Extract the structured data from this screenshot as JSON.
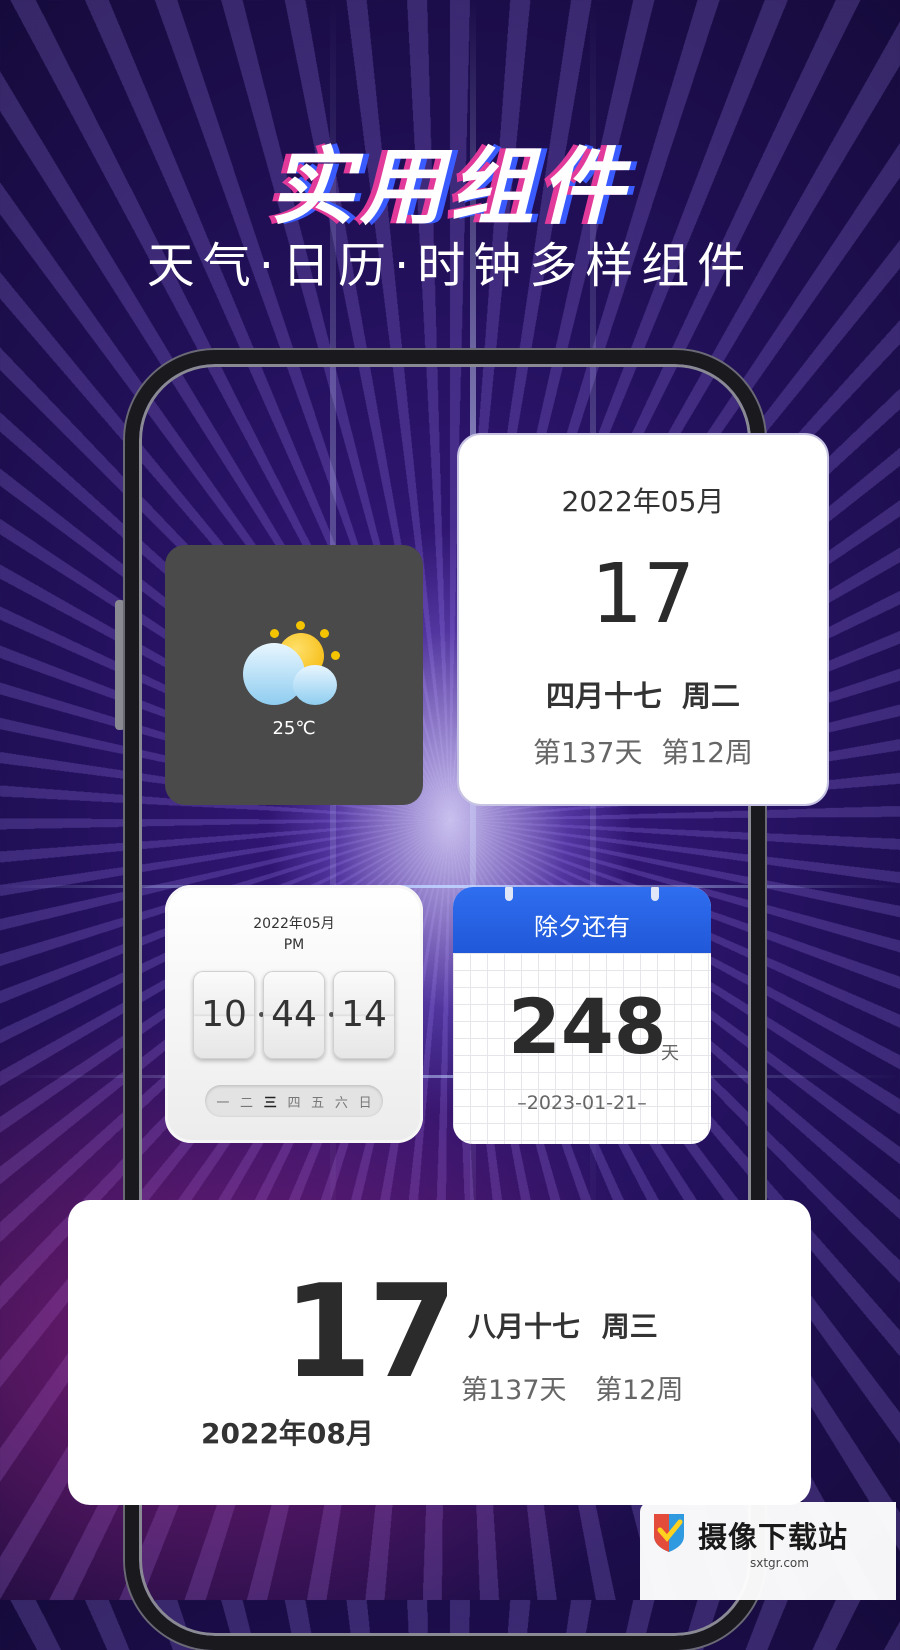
{
  "header": {
    "title": "实用组件",
    "subtitle": "天气·日历·时钟多样组件"
  },
  "weather_widget": {
    "temperature": "25℃",
    "icon": "partly-cloudy-icon"
  },
  "calendar_widget": {
    "year_month": "2022年05月",
    "day": "17",
    "lunar_weekday": "四月十七  周二",
    "day_week_info": "第137天  第12周"
  },
  "flip_clock_widget": {
    "year_month": "2022年05月",
    "period": "PM",
    "hours": "10",
    "minutes": "44",
    "seconds": "14",
    "weekdays": [
      "一",
      "二",
      "三",
      "四",
      "五",
      "六",
      "日"
    ],
    "active_weekday": "三"
  },
  "countdown_widget": {
    "header": "除夕还有",
    "days": "248",
    "unit": "天",
    "date": "–2023-01-21–",
    "accent_color": "#2563E8"
  },
  "large_calendar_widget": {
    "day": "17",
    "year_month": "2022年08月",
    "lunar_weekday": "八月十七  周三",
    "day_week_info": "第137天  第12周"
  },
  "watermark": {
    "brand": "摄像下载站",
    "site": "sxtgr.com"
  }
}
